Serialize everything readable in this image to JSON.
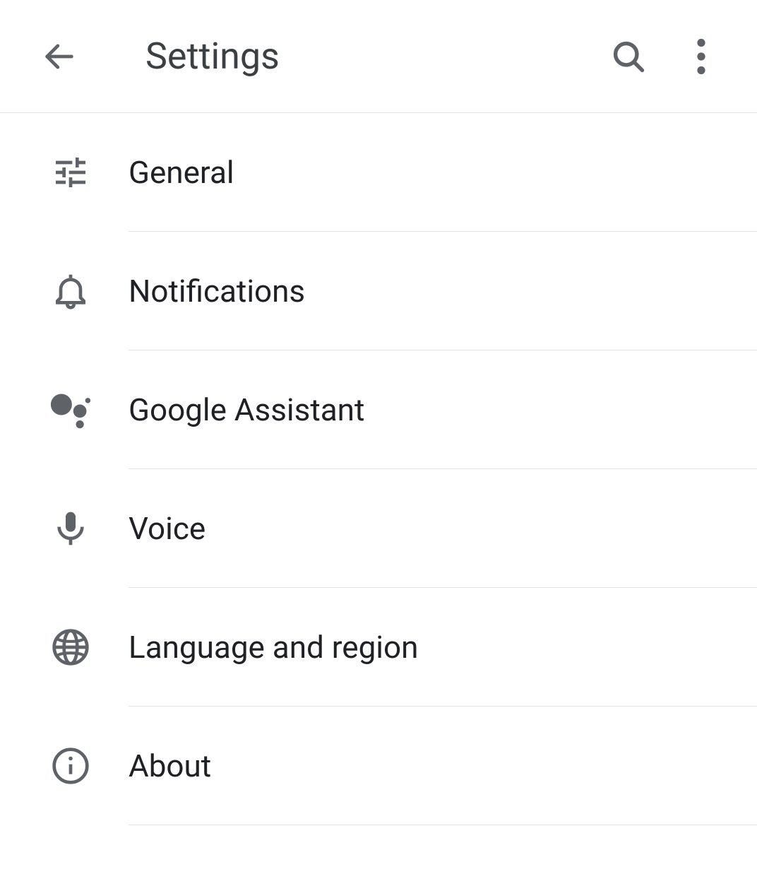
{
  "header": {
    "title": "Settings"
  },
  "items": [
    {
      "label": "General"
    },
    {
      "label": "Notifications"
    },
    {
      "label": "Google Assistant"
    },
    {
      "label": "Voice"
    },
    {
      "label": "Language and region"
    },
    {
      "label": "About"
    }
  ]
}
